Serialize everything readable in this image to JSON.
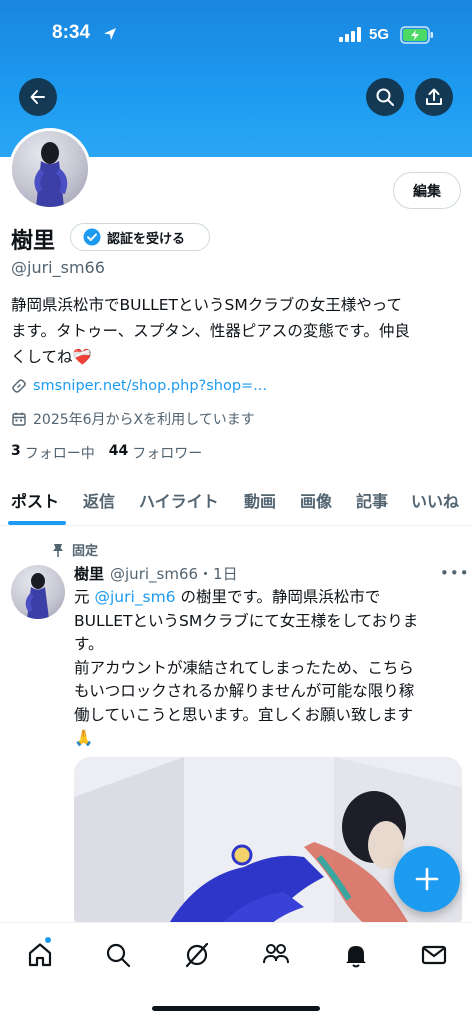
{
  "status_bar": {
    "time": "8:34",
    "network": "5G"
  },
  "profile": {
    "display_name": "樹里",
    "verify_label": "認証を受ける",
    "handle": "@juri_sm66",
    "edit_label": "編集",
    "bio_lines": [
      "静岡県浜松市でBULLETというSMクラブの女王様やって",
      "ます。タトゥー、スプタン、性器ピアスの変態です。仲良",
      "くしてね"
    ],
    "bio_emoji": "❤️‍🩹",
    "link": "smsniper.net/shop.php?shop=...",
    "joined": "2025年6月からXを利用しています",
    "following_count": "3",
    "following_label": "フォロー中",
    "followers_count": "44",
    "followers_label": "フォロワー"
  },
  "tabs": [
    "ポスト",
    "返信",
    "ハイライト",
    "動画",
    "画像",
    "記事",
    "いいね"
  ],
  "pinned_tweet": {
    "pinned_label": "固定",
    "name": "樹里",
    "meta": "@juri_sm66・1日",
    "text_prefix": "元 ",
    "mention": "@juri_sm6",
    "text_line1_rest": " の樹里です。静岡県浜松市で",
    "text_lines": [
      "BULLETというSMクラブにて女王様をしておりま",
      "す。",
      "前アカウントが凍結されてしまったため、こちら",
      "もいつロックされるか解りませんが可能な限り稼",
      "働していこうと思います。宜しくお願い致します"
    ],
    "text_emoji": "🙏"
  },
  "bottom_nav": [
    "home-icon",
    "search-icon",
    "grok-icon",
    "communities-icon",
    "notifications-icon",
    "messages-icon"
  ],
  "colors": {
    "accent": "#1d9bf0",
    "text": "#0f1419",
    "secondary": "#536471"
  }
}
